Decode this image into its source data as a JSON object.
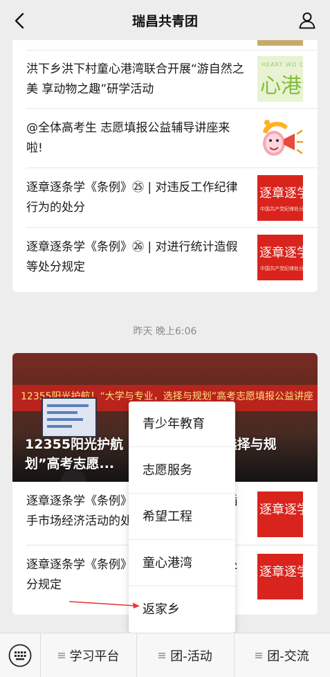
{
  "header": {
    "title": "瑞昌共青团",
    "back_icon": "back-chevron-icon",
    "user_icon": "user-profile-icon"
  },
  "feed_top": {
    "articles": [
      {
        "title": "洪下乡洪下村童心港湾联合开展“游自然之美 享动物之趣”研学活动",
        "thumb_text": "心港湾",
        "thumb_small": "HEART WO CHUN"
      },
      {
        "title": "@全体高考生 志愿填报公益辅导讲座来啦!"
      },
      {
        "title": "逐章逐条学《条例》㉕ | 对违反工作纪律行为的处分",
        "thumb_text": "逐章逐学",
        "thumb_small": "中国共产党纪律处分"
      },
      {
        "title": "逐章逐条学《条例》㉖ | 对进行统计造假等处分规定",
        "thumb_text": "逐章逐学",
        "thumb_small": "中国共产党纪律处分"
      }
    ]
  },
  "timestamp": "昨天 晚上6:06",
  "feed_bottom": {
    "hero": {
      "banner": "12355阳光护航！“大学与专业，选择与规划”高考志愿填报公益讲座",
      "title": "12355阳光护航丨“大学与专业，选择与规划”高考志愿..."
    },
    "articles": [
      {
        "title": "逐章逐条学《条例》㉗ | 对违规干预和插手市场经济活动的处分规定",
        "thumb_text": "逐章逐学"
      },
      {
        "title": "逐章逐条学《条例》㉘ | 对违规行为等处分规定",
        "thumb_text": "逐章逐学"
      }
    ]
  },
  "popup_menu": {
    "items": [
      "青少年教育",
      "志愿服务",
      "希望工程",
      "童心港湾",
      "返家乡"
    ]
  },
  "bottom_bar": {
    "keyboard_icon": "keyboard-icon",
    "tabs": [
      "学习平台",
      "团-活动",
      "团-交流"
    ]
  },
  "colors": {
    "background": "#ededed",
    "card": "#ffffff",
    "thumb_red": "#d8241d",
    "annotation_arrow": "#e53935"
  }
}
